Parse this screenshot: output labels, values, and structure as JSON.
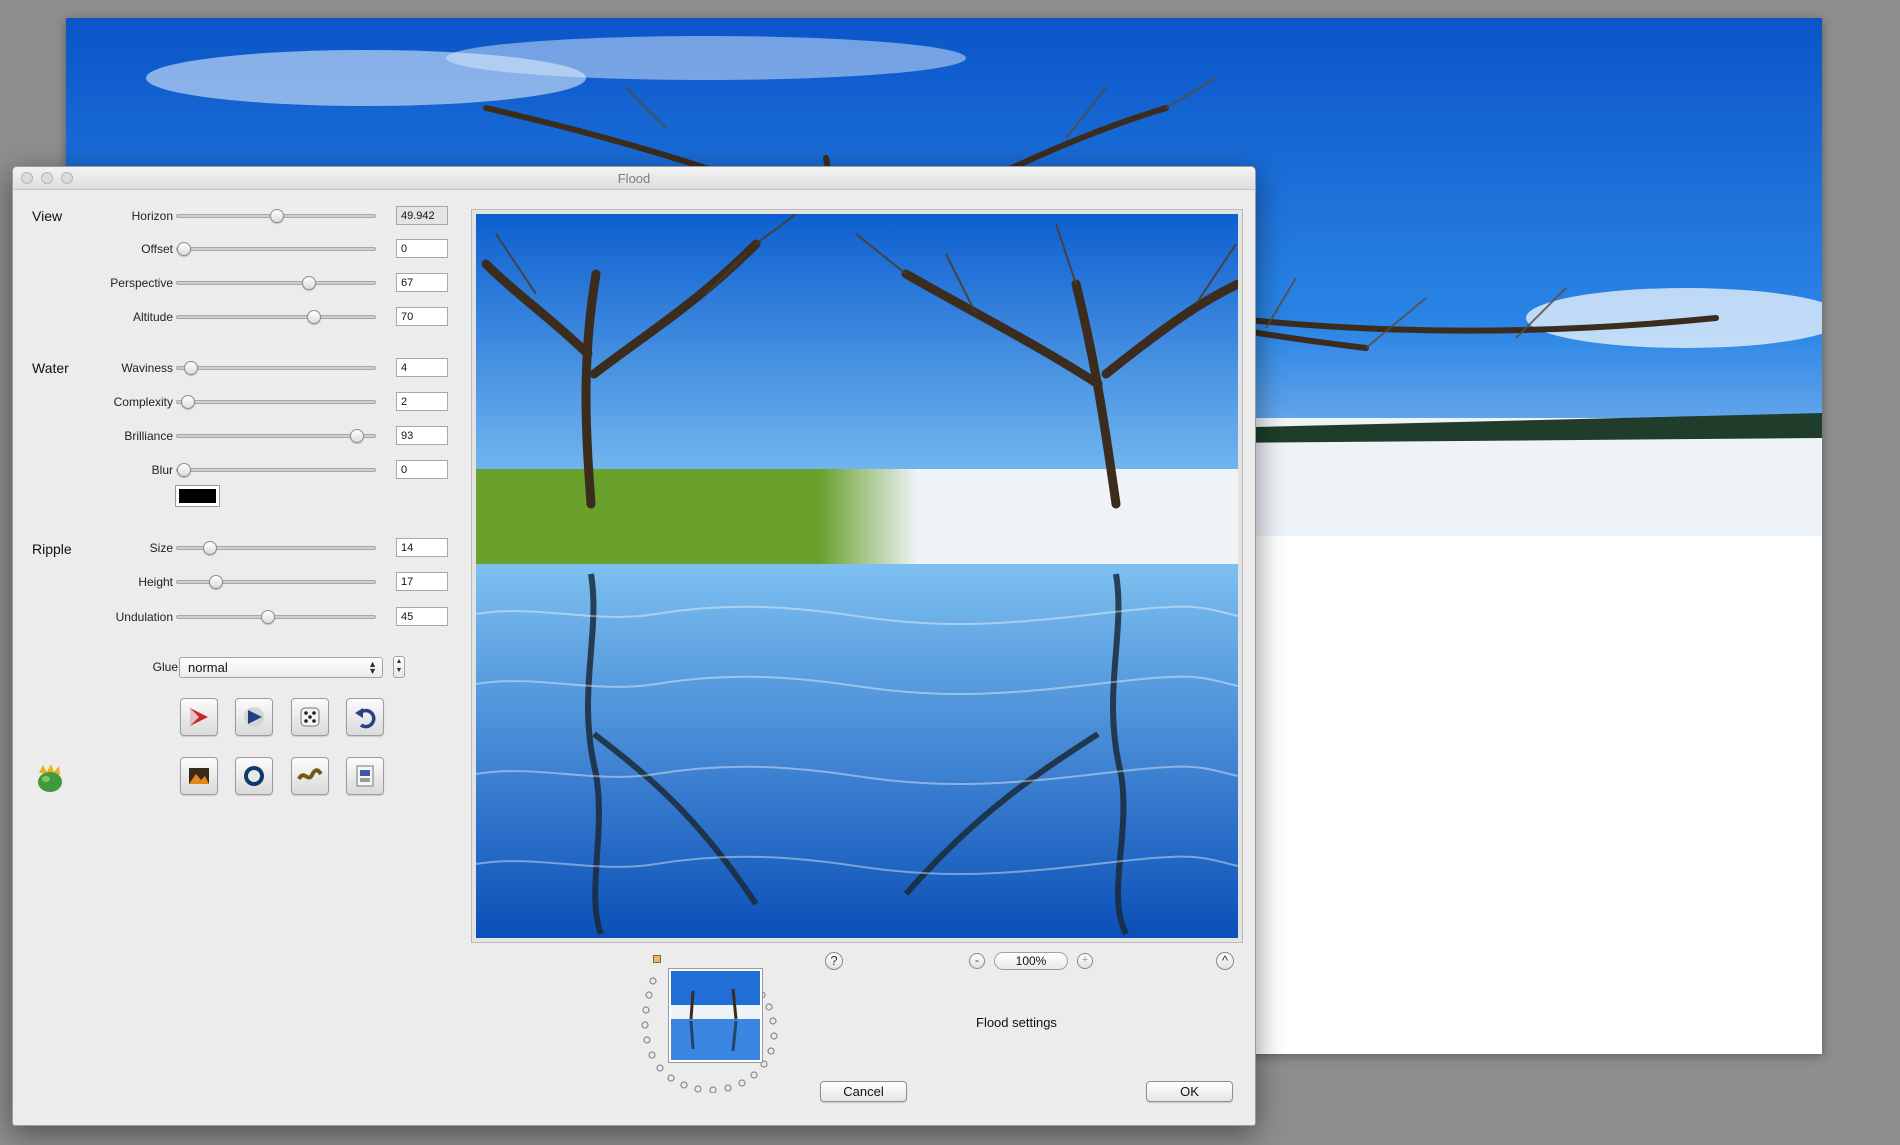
{
  "window": {
    "title": "Flood"
  },
  "groups": {
    "view": "View",
    "water": "Water",
    "ripple": "Ripple"
  },
  "params": [
    {
      "id": "horizon",
      "label": "Horizon",
      "value": "49.942",
      "level": 0.5
    },
    {
      "id": "offset",
      "label": "Offset",
      "value": "0",
      "level": 0.0
    },
    {
      "id": "perspective",
      "label": "Perspective",
      "value": "67",
      "level": 0.67
    },
    {
      "id": "altitude",
      "label": "Altitude",
      "value": "70",
      "level": 0.7
    },
    {
      "id": "waviness",
      "label": "Waviness",
      "value": "4",
      "level": 0.04
    },
    {
      "id": "complexity",
      "label": "Complexity",
      "value": "2",
      "level": 0.02
    },
    {
      "id": "brilliance",
      "label": "Brilliance",
      "value": "93",
      "level": 0.93
    },
    {
      "id": "blur",
      "label": "Blur",
      "value": "0",
      "level": 0.0
    },
    {
      "id": "size",
      "label": "Size",
      "value": "14",
      "level": 0.14
    },
    {
      "id": "height",
      "label": "Height",
      "value": "17",
      "level": 0.17
    },
    {
      "id": "undulation",
      "label": "Undulation",
      "value": "45",
      "level": 0.45
    }
  ],
  "water_color": "#000000",
  "glue": {
    "label": "Glue",
    "value": "normal"
  },
  "toolbar_icons": [
    "render-icon",
    "play-icon",
    "dice-icon",
    "undo-icon",
    "image-icon",
    "ring-icon",
    "wave-icon",
    "psd-icon"
  ],
  "zoom": {
    "minus": "-",
    "value": "100%",
    "plus": "+"
  },
  "help": "?",
  "collapse": "^",
  "status": "Flood settings",
  "buttons": {
    "cancel": "Cancel",
    "ok": "OK"
  },
  "colors": {
    "sky": "#1f6fd6",
    "grass": "#6aa02c",
    "snow": "#eef3f8"
  }
}
